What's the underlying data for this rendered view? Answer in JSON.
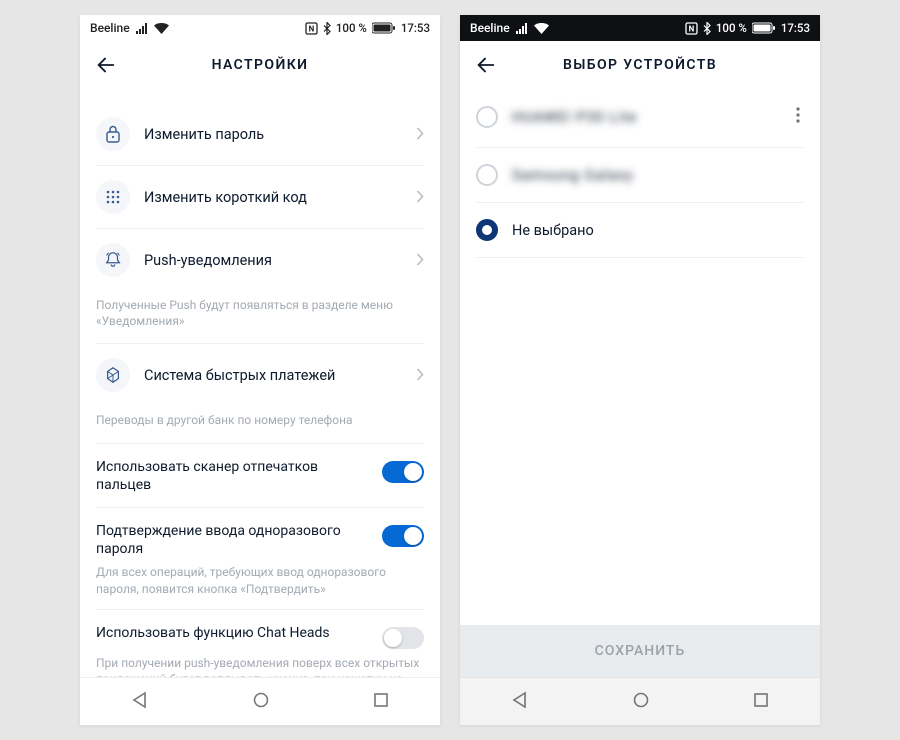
{
  "statusbar": {
    "carrier": "Beeline",
    "battery": "100 %",
    "time": "17:53"
  },
  "screen1": {
    "title": "НАСТРОЙКИ",
    "items": {
      "change_password": "Изменить пароль",
      "change_shortcode": "Изменить короткий код",
      "push": "Push-уведомления",
      "push_note": "Полученные Push будут появляться в разделе меню «Уведомления»",
      "sbp": "Система быстрых платежей",
      "sbp_note": "Переводы в другой банк по номеру телефона"
    },
    "toggles": {
      "fingerprint_label": "Использовать сканер отпечатков пальцев",
      "otp_label": "Подтверждение ввода одноразового пароля",
      "otp_desc": "Для всех операций, требующих ввод одноразового пароля, появится кнопка «Подтвердить»",
      "chatheads_label": "Использовать функцию Chat Heads",
      "chatheads_desc": "При получении push-уведомления поверх всех открытых приложений будет всплывать иконка, при нажатии на которую можно посмотреть недавние push-уведомления"
    }
  },
  "screen2": {
    "title": "ВЫБОР УСТРОЙСТВ",
    "device1": "HUAWEI P30 Lite",
    "device2": "Samsung Galaxy",
    "none": "Не выбрано",
    "save": "СОХРАНИТЬ"
  }
}
